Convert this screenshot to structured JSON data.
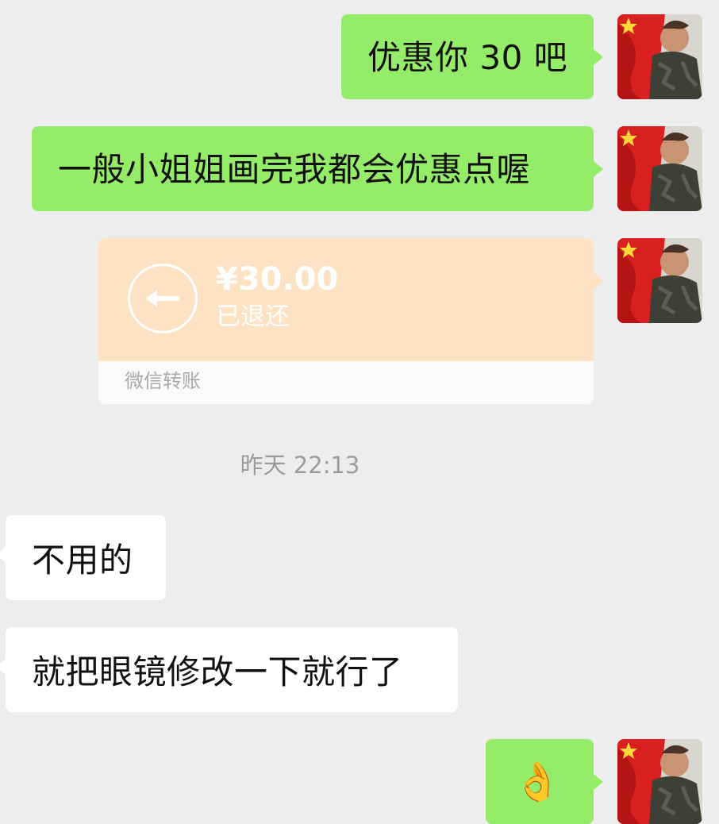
{
  "messages": [
    {
      "text": "优惠你 30 吧",
      "side": "right"
    },
    {
      "text": "一般小姐姐画完我都会优惠点喔",
      "side": "right"
    },
    {
      "text": "不用的",
      "side": "left"
    },
    {
      "text": "就把眼镜修改一下就行了",
      "side": "left"
    },
    {
      "text": "👌",
      "side": "right"
    }
  ],
  "transfer": {
    "amount": "¥30.00",
    "status": "已退还",
    "footer": "微信转账",
    "icon": "return-arrow-icon",
    "color": "#fde2c4"
  },
  "timestamp": "昨天 22:13",
  "colors": {
    "background": "#ededed",
    "outgoing_bubble": "#95ec69",
    "incoming_bubble": "#ffffff",
    "transfer_card": "#fde2c4"
  }
}
